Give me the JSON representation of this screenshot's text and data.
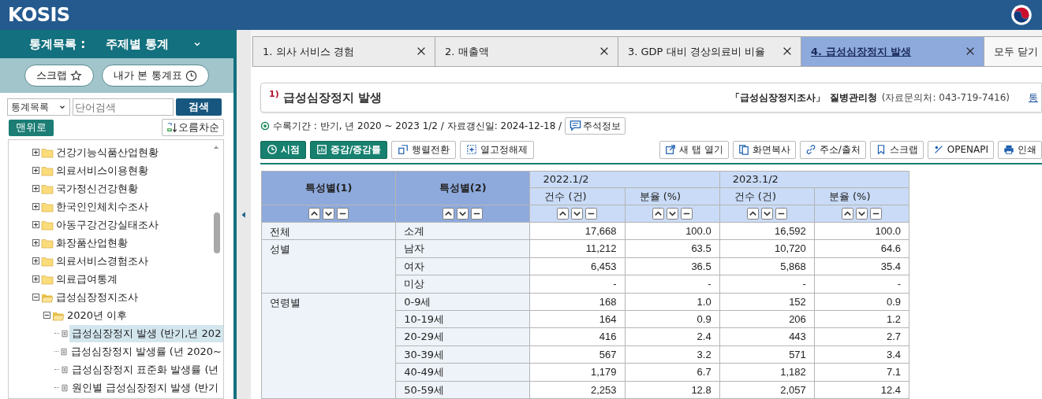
{
  "header": {
    "logo": "KOSIS"
  },
  "sidebar": {
    "title_label": "통계목록 :",
    "title_value": "주제별 통계",
    "buttons": [
      "스크랩",
      "내가 본 통계표"
    ],
    "search": {
      "select": "통계목록",
      "placeholder": "단어검색",
      "button": "검색"
    },
    "top_button": "맨위로",
    "sort_button": "오름차순",
    "tree": [
      {
        "kind": "folder",
        "label": "건강기능식품산업현황",
        "expanded": false
      },
      {
        "kind": "folder",
        "label": "의료서비스이용현황",
        "expanded": false
      },
      {
        "kind": "folder",
        "label": "국가정신건강현황",
        "expanded": false
      },
      {
        "kind": "folder",
        "label": "한국인인체치수조사",
        "expanded": false
      },
      {
        "kind": "folder",
        "label": "아동구강건강실태조사",
        "expanded": false
      },
      {
        "kind": "folder",
        "label": "화장품산업현황",
        "expanded": false
      },
      {
        "kind": "folder",
        "label": "의료서비스경험조사",
        "expanded": false
      },
      {
        "kind": "folder",
        "label": "의료급여통계",
        "expanded": false
      },
      {
        "kind": "folder",
        "label": "급성심장정지조사",
        "expanded": true,
        "children": [
          {
            "kind": "folder",
            "label": "2020년 이후",
            "expanded": true,
            "children": [
              {
                "kind": "table",
                "label": "급성심장정지 발생 (반기,년 202",
                "selected": true
              },
              {
                "kind": "table",
                "label": "급성심장정지 발생률 (년 2020~",
                "selected": false
              },
              {
                "kind": "table",
                "label": "급성심장정지 표준화 발생률 (년",
                "selected": false
              },
              {
                "kind": "table",
                "label": "원인별 급성심장정지 발생 (반기",
                "selected": false
              }
            ]
          }
        ]
      }
    ]
  },
  "tabs": [
    {
      "label": "1. 의사 서비스 경험",
      "selected": false
    },
    {
      "label": "2. 매출액",
      "selected": false
    },
    {
      "label": "3. GDP 대비 경상의료비 비율",
      "selected": false
    },
    {
      "label": "4. 급성심장정지 발생",
      "selected": true
    }
  ],
  "close_all": "모두 닫기",
  "title": {
    "mark": "1)",
    "text": "급성심장정지 발생",
    "source": "「급성심장정지조사」",
    "agency": "질병관리청",
    "contact": "(자료문의처: 043-719-7416)",
    "link": "통"
  },
  "info": {
    "period": "수록기간 : 반기, 년 2020 ~ 2023 1/2 / 자료갱신일: 2024-12-18 /",
    "note_button": "주석정보"
  },
  "toolbar_left": [
    {
      "label": "시점",
      "kind": "primary"
    },
    {
      "label": "증감/증감률",
      "kind": "primary"
    },
    {
      "label": "행렬전환",
      "kind": "secondary"
    },
    {
      "label": "열고정해제",
      "kind": "secondary"
    }
  ],
  "toolbar_right": [
    "새 탭 열기",
    "화면복사",
    "주소/출처",
    "스크랩",
    "OPENAPI",
    "인쇄"
  ],
  "table": {
    "row_headers": [
      "특성별(1)",
      "특성별(2)"
    ],
    "periods": [
      {
        "label": "2022.1/2",
        "columns": [
          "건수 (건)",
          "분율 (%)"
        ]
      },
      {
        "label": "2023.1/2",
        "columns": [
          "건수 (건)",
          "분율 (%)"
        ]
      }
    ],
    "groups": [
      {
        "label": "전체",
        "rows": [
          {
            "label": "소계",
            "values": [
              "17,668",
              "100.0",
              "16,592",
              "100.0"
            ]
          }
        ]
      },
      {
        "label": "성별",
        "rows": [
          {
            "label": "남자",
            "values": [
              "11,212",
              "63.5",
              "10,720",
              "64.6"
            ]
          },
          {
            "label": "여자",
            "values": [
              "6,453",
              "36.5",
              "5,868",
              "35.4"
            ]
          },
          {
            "label": "미상",
            "values": [
              "-",
              "-",
              "-",
              "-"
            ]
          }
        ]
      },
      {
        "label": "연령별",
        "rows": [
          {
            "label": "0-9세",
            "values": [
              "168",
              "1.0",
              "152",
              "0.9"
            ]
          },
          {
            "label": "10-19세",
            "values": [
              "164",
              "0.9",
              "206",
              "1.2"
            ]
          },
          {
            "label": "20-29세",
            "values": [
              "416",
              "2.4",
              "443",
              "2.7"
            ]
          },
          {
            "label": "30-39세",
            "values": [
              "567",
              "3.2",
              "571",
              "3.4"
            ]
          },
          {
            "label": "40-49세",
            "values": [
              "1,179",
              "6.7",
              "1,182",
              "7.1"
            ]
          },
          {
            "label": "50-59세",
            "values": [
              "2,253",
              "12.8",
              "2,057",
              "12.4"
            ]
          }
        ]
      }
    ]
  }
}
